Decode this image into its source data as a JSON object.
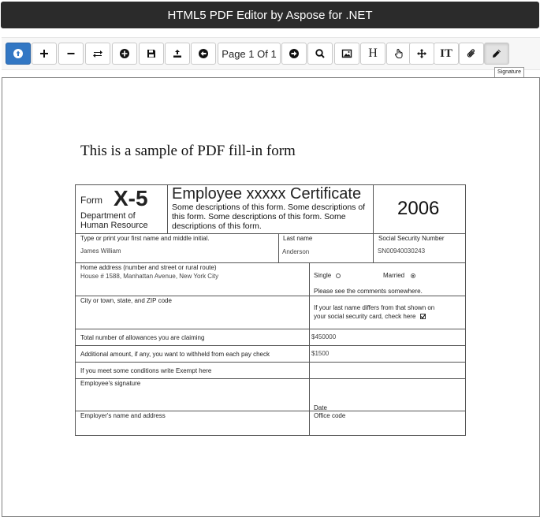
{
  "app": {
    "title": "HTML5 PDF Editor by Aspose for .NET"
  },
  "toolbar": {
    "page_indicator": "Page 1 Of 1",
    "tooltip": "Signature",
    "heading_btn": "H",
    "text_btn": "IT"
  },
  "document": {
    "heading": "This is a sample of PDF fill-in form",
    "form": {
      "form_label": "Form",
      "form_number": "X-5",
      "department_line1": "Department of",
      "department_line2": "Human Resource",
      "title": "Employee xxxxx Certificate",
      "description": "Some descriptions of this form. Some descriptions of this form. Some descriptions of this form. Some descriptions of this form.",
      "year": "2006",
      "first_name_label": "Type or print your first name and middle initial.",
      "first_name_value": "James William",
      "last_name_label": "Last name",
      "last_name_value": "Anderson",
      "ssn_label": "Social Security Number",
      "ssn_value": "SN00940030243",
      "home_address_label": "Home address (number and street or rural route)",
      "home_address_value": "House # 1588, Manhattan Avenue, New York City",
      "single_label": "Single",
      "married_label": "Married",
      "comments_note": "Please see the comments somewhere.",
      "city_label": "City or town, state, and ZIP code",
      "last_name_diff_line1": "If your last name differs from that shown on",
      "last_name_diff_line2": "your social security card, check here",
      "allowances_label": "Total number of allowances you are claiming",
      "allowances_value": "$450000",
      "additional_label": "Additional amount, if any, you want to withheld from each pay check",
      "additional_value": "$1500",
      "exempt_label": "If you meet some conditions write Exempt here",
      "signature_label": "Employee's signature",
      "date_label": "Date",
      "employer_label": "Employer's name and address",
      "office_label": "Office code"
    }
  }
}
